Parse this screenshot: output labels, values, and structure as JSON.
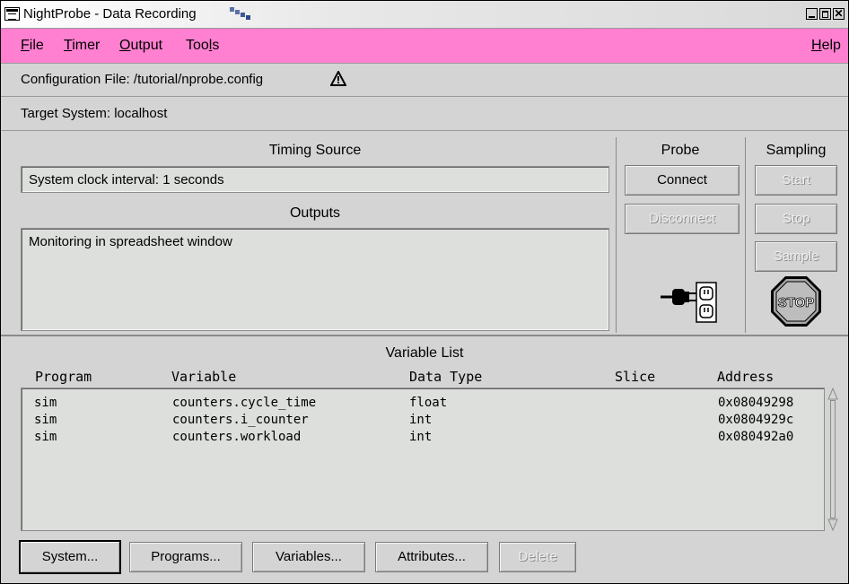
{
  "window": {
    "title": "NightProbe - Data Recording",
    "controls": [
      "minimize",
      "maximize",
      "close"
    ]
  },
  "menubar": {
    "items": [
      {
        "label": "File",
        "mnemonic": "F"
      },
      {
        "label": "Timer",
        "mnemonic": "T"
      },
      {
        "label": "Output",
        "mnemonic": "O"
      },
      {
        "label": "Tools",
        "mnemonic": "l"
      }
    ],
    "help": "Help"
  },
  "config": {
    "label": "Configuration File: /tutorial/nprobe.config",
    "warning_icon": "warning-icon"
  },
  "target": {
    "label": "Target System: localhost"
  },
  "timing": {
    "header": "Timing Source",
    "value": "System clock interval: 1 seconds"
  },
  "outputs": {
    "header": "Outputs",
    "value": "Monitoring in spreadsheet window"
  },
  "probe": {
    "header": "Probe",
    "connect": "Connect",
    "disconnect": "Disconnect",
    "status_icon": "plug-outlet-icon"
  },
  "sampling": {
    "header": "Sampling",
    "start": "Start",
    "stop": "Stop",
    "sample": "Sample",
    "status_icon": "stop-sign-icon",
    "stop_sign_text": "STOP"
  },
  "variable_list": {
    "title": "Variable List",
    "columns": [
      "Program",
      "Variable",
      "Data Type",
      "Slice",
      "Address"
    ],
    "rows": [
      {
        "program": "sim",
        "variable": "counters.cycle_time",
        "type": "float",
        "slice": "",
        "address": "0x08049298"
      },
      {
        "program": "sim",
        "variable": "counters.i_counter",
        "type": "int",
        "slice": "",
        "address": "0x0804929c"
      },
      {
        "program": "sim",
        "variable": "counters.workload",
        "type": "int",
        "slice": "",
        "address": "0x080492a0"
      }
    ]
  },
  "bottom_buttons": {
    "system": "System...",
    "programs": "Programs...",
    "variables": "Variables...",
    "attributes": "Attributes...",
    "delete": "Delete"
  },
  "colors": {
    "menubar": "#ff7fd0",
    "background": "#d4d4d4",
    "field": "#dcdfdc"
  }
}
